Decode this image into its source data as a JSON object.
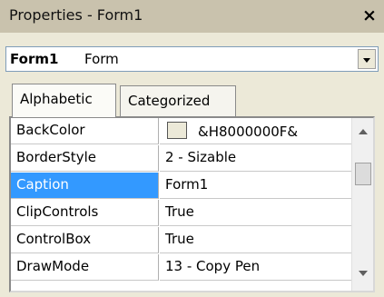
{
  "window": {
    "title": "Properties - Form1",
    "close_glyph": "×"
  },
  "object_selector": {
    "name": "Form1",
    "type": "Form"
  },
  "tabs": [
    {
      "label": "Alphabetic",
      "active": true
    },
    {
      "label": "Categorized",
      "active": false
    }
  ],
  "properties": [
    {
      "name": "BackColor",
      "value": "&H8000000F&",
      "has_swatch": true
    },
    {
      "name": "BorderStyle",
      "value": "2 - Sizable"
    },
    {
      "name": "Caption",
      "value": "Form1",
      "selected": true
    },
    {
      "name": "ClipControls",
      "value": "True"
    },
    {
      "name": "ControlBox",
      "value": "True"
    },
    {
      "name": "DrawMode",
      "value": "13 - Copy Pen"
    }
  ],
  "colors": {
    "selection": "#3399ff",
    "titlebar": "#c9c2ad"
  }
}
